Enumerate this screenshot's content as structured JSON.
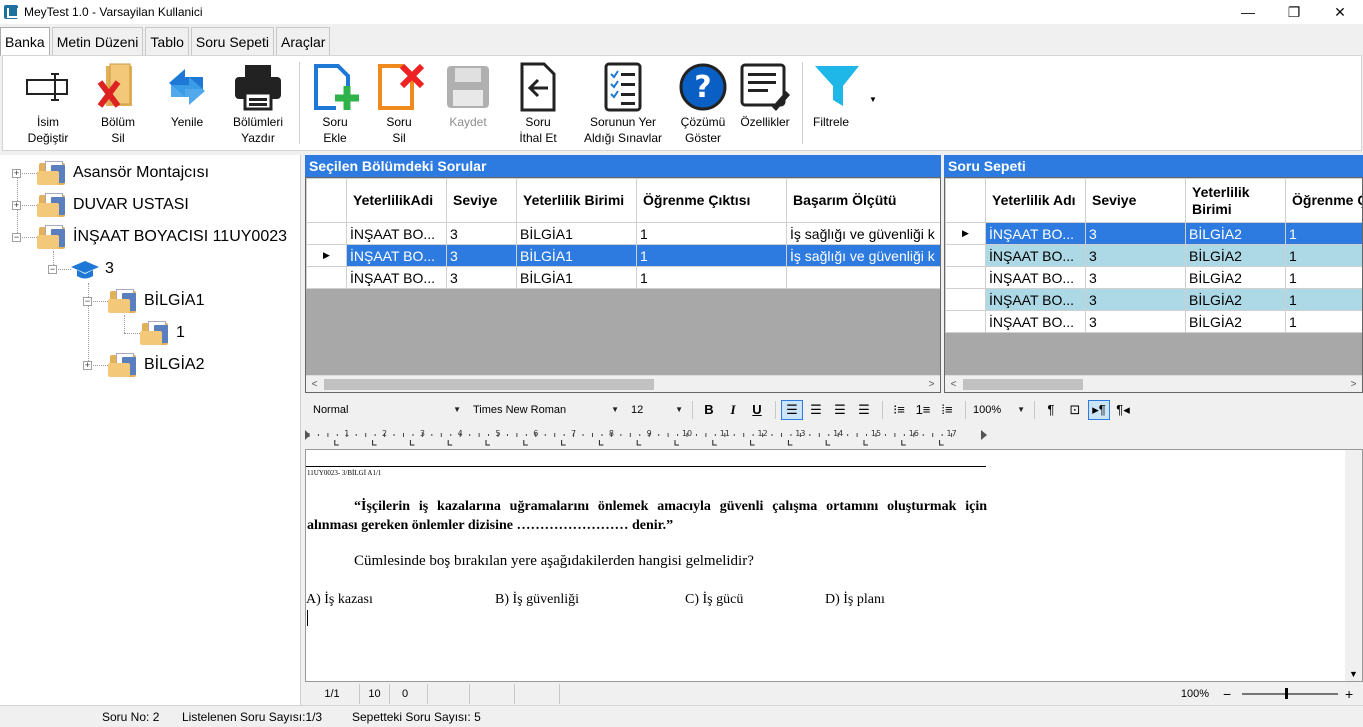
{
  "window": {
    "title": "MeyTest 1.0  -  Varsayilan Kullanici",
    "minimize": "—",
    "maximize": "❐",
    "close": "✕"
  },
  "tabs": [
    "Banka",
    "Metin Düzeni",
    "Tablo",
    "Soru Sepeti",
    "Araçlar"
  ],
  "ribbon": {
    "isim_degistir": [
      "İsim",
      "Değiştir"
    ],
    "bolum_sil": [
      "Bölüm",
      "Sil"
    ],
    "yenile": "Yenile",
    "bolumleri_yazdir": [
      "Bölümleri",
      "Yazdır"
    ],
    "soru_ekle": [
      "Soru",
      "Ekle"
    ],
    "soru_sil": [
      "Soru",
      "Sil"
    ],
    "kaydet": "Kaydet",
    "soru_ithal_et": [
      "Soru",
      "İthal Et"
    ],
    "sorunun_yer_aldigi": [
      "Sorunun Yer",
      "Aldığı Sınavlar"
    ],
    "cozumu_goster": [
      "Çözümü",
      "Göster"
    ],
    "ozellikler": "Özellikler",
    "filtrele": "Filtrele"
  },
  "tree": {
    "nodes": [
      {
        "label": "Asansör Montajcısı"
      },
      {
        "label": "DUVAR USTASI"
      },
      {
        "label": "İNŞAAT BOYACISI 11UY0023"
      },
      {
        "label": "3"
      },
      {
        "label": "BİLGİA1"
      },
      {
        "label": "1"
      },
      {
        "label": "BİLGİA2"
      }
    ]
  },
  "questions_panel": {
    "title": "Seçilen Bölümdeki Sorular",
    "columns": [
      "YeterlilikAdi",
      "Seviye",
      "Yeterlilik Birimi",
      "Öğrenme Çıktısı",
      "Başarım Ölçütü"
    ],
    "rows": [
      [
        "İNŞAAT BO...",
        "3",
        "BİLGİA1",
        "1",
        "İş sağlığı ve güvenliği k"
      ],
      [
        "İNŞAAT BO...",
        "3",
        "BİLGİA1",
        "1",
        "İş sağlığı ve güvenliği k"
      ],
      [
        "İNŞAAT BO...",
        "3",
        "BİLGİA1",
        "1",
        ""
      ]
    ],
    "selected_row": 1
  },
  "basket_panel": {
    "title": "Soru Sepeti",
    "columns": [
      "Yeterlilik Adı",
      "Seviye",
      "Yeterlilik Birimi",
      "Öğrenme Çıktısı"
    ],
    "rows": [
      [
        "İNŞAAT BO...",
        "3",
        "BİLGİA2",
        "1"
      ],
      [
        "İNŞAAT BO...",
        "3",
        "BİLGİA2",
        "1"
      ],
      [
        "İNŞAAT BO...",
        "3",
        "BİLGİA2",
        "1"
      ],
      [
        "İNŞAAT BO...",
        "3",
        "BİLGİA2",
        "1"
      ],
      [
        "İNŞAAT BO...",
        "3",
        "BİLGİA2",
        "1"
      ]
    ],
    "selected_row": 0
  },
  "format_toolbar": {
    "style": "Normal",
    "font": "Times New Roman",
    "size": "12",
    "zoom": "100%"
  },
  "ruler_marks": [
    "1",
    "2",
    "3",
    "4",
    "5",
    "6",
    "7",
    "8",
    "9",
    "10",
    "11",
    "12",
    "13",
    "14",
    "15",
    "16",
    "17"
  ],
  "editor": {
    "header": "11UY0023- 3/BİLGİ A1/1",
    "question_line1": "“İşçilerin iş kazalarına uğramalarını önlemek amacıyla güvenli çalışma ortamını oluşturmak için",
    "question_line2": "alınması gereken önlemler dizisine …………………… denir.”",
    "prompt": "Cümlesinde boş bırakılan yere aşağıdakilerden hangisi gelmelidir?",
    "options": [
      "A) İş kazası",
      "B) İş güvenliği",
      "C) İş gücü",
      "D) İş planı"
    ]
  },
  "editor_status": {
    "page": "1/1",
    "line": "10",
    "col": "0",
    "zoom": "100%"
  },
  "status": {
    "soru_no": "Soru No: 2",
    "listelenen": "Listelenen Soru Sayısı:1/3",
    "sepetteki": "Sepetteki Soru Sayısı: 5"
  },
  "colors": {
    "accent": "#2d7be0",
    "alt_row": "#add8e6"
  }
}
